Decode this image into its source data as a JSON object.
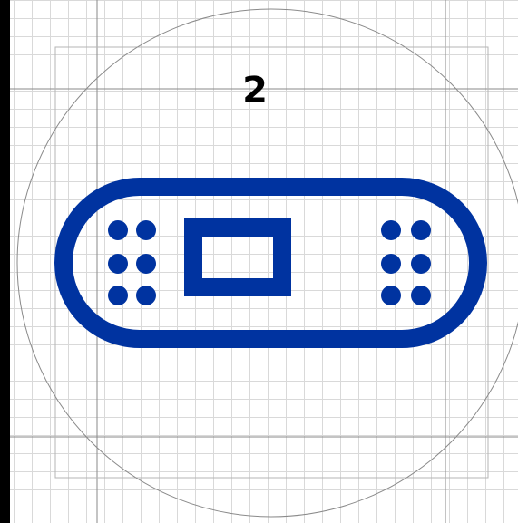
{
  "step_number": "2",
  "icon": {
    "name": "adhesive-bandage-icon",
    "color": "#0033a0"
  },
  "guide": {
    "grid_color": "#d9d9d9",
    "guide_line_color": "#8a8a8a",
    "circle_color": "#8a8a8a"
  }
}
